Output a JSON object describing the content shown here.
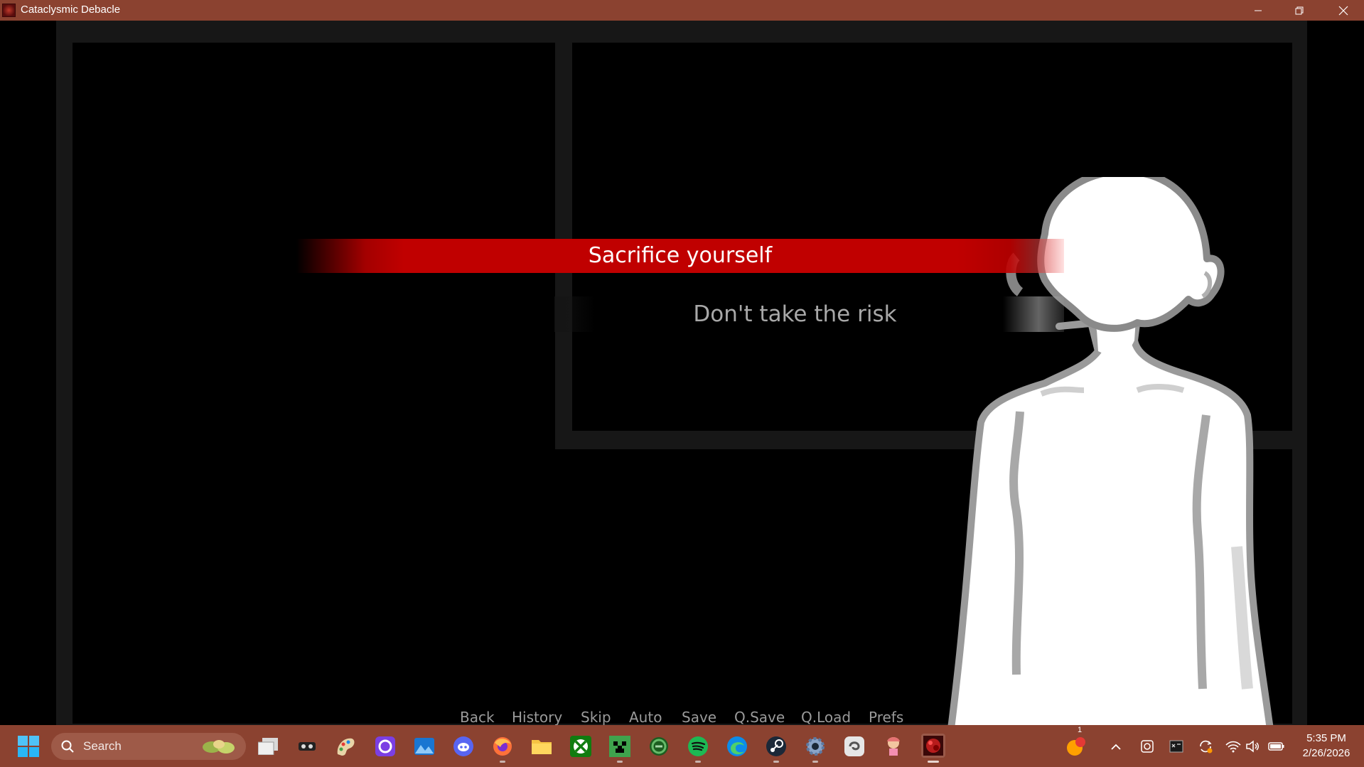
{
  "window": {
    "title": "Cataclysmic Debacle",
    "controls": [
      "minimize-icon",
      "restore-icon",
      "close-icon"
    ]
  },
  "game": {
    "choices": [
      {
        "label": "Sacrifice yourself",
        "selected": true
      },
      {
        "label": "Don't take the risk",
        "selected": false
      }
    ],
    "quick_menu": [
      "Back",
      "History",
      "Skip",
      "Auto",
      "Save",
      "Q.Save",
      "Q.Load",
      "Prefs"
    ],
    "colors": {
      "accent": "#c00000",
      "panel": "#171717",
      "menu_text": "#9a9a9a",
      "chrome": "#8b4230"
    }
  },
  "taskbar": {
    "search_placeholder": "Search",
    "apps": [
      "task-view-icon",
      "app-icon",
      "paint-icon",
      "app-icon",
      "photos-icon",
      "discord-icon",
      "firefox-icon",
      "file-explorer-icon",
      "xbox-icon",
      "minecraft-icon",
      "app-icon",
      "spotify-icon",
      "edge-icon",
      "steam-icon",
      "settings-icon",
      "app-icon",
      "app-icon",
      "cataclysmic-debacle-icon"
    ],
    "notification_badge": "1",
    "clock": {
      "time": "5:35 PM",
      "date": "2/26/2026"
    }
  }
}
